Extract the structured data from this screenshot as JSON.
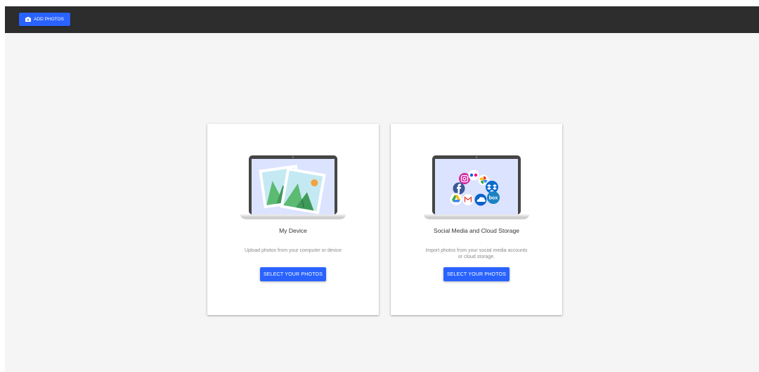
{
  "toolbar": {
    "add_photos_label": "ADD PHOTOS",
    "add_photos_icon": "camera-plus-icon",
    "background": "#2d2d2d"
  },
  "colors": {
    "accent": "#2962ff",
    "page_background": "#f5f5f5",
    "card_background": "#ffffff"
  },
  "cards": [
    {
      "title": "My Device",
      "description": "Upload photos from your computer or device",
      "button_label": "SELECT YOUR PHOTOS",
      "illustration": "laptop-photos-illustration"
    },
    {
      "title": "Social Media and Cloud Storage",
      "description": "Import photos from your social media accounts or cloud storage.",
      "button_label": "SELECT YOUR PHOTOS",
      "illustration": "laptop-social-cloud-illustration",
      "service_icons": [
        "instagram-icon",
        "flickr-icon",
        "google-photos-icon",
        "facebook-icon",
        "dropbox-icon",
        "google-drive-icon",
        "gmail-icon",
        "onedrive-icon",
        "box-icon"
      ],
      "box_icon_text": "box"
    }
  ]
}
